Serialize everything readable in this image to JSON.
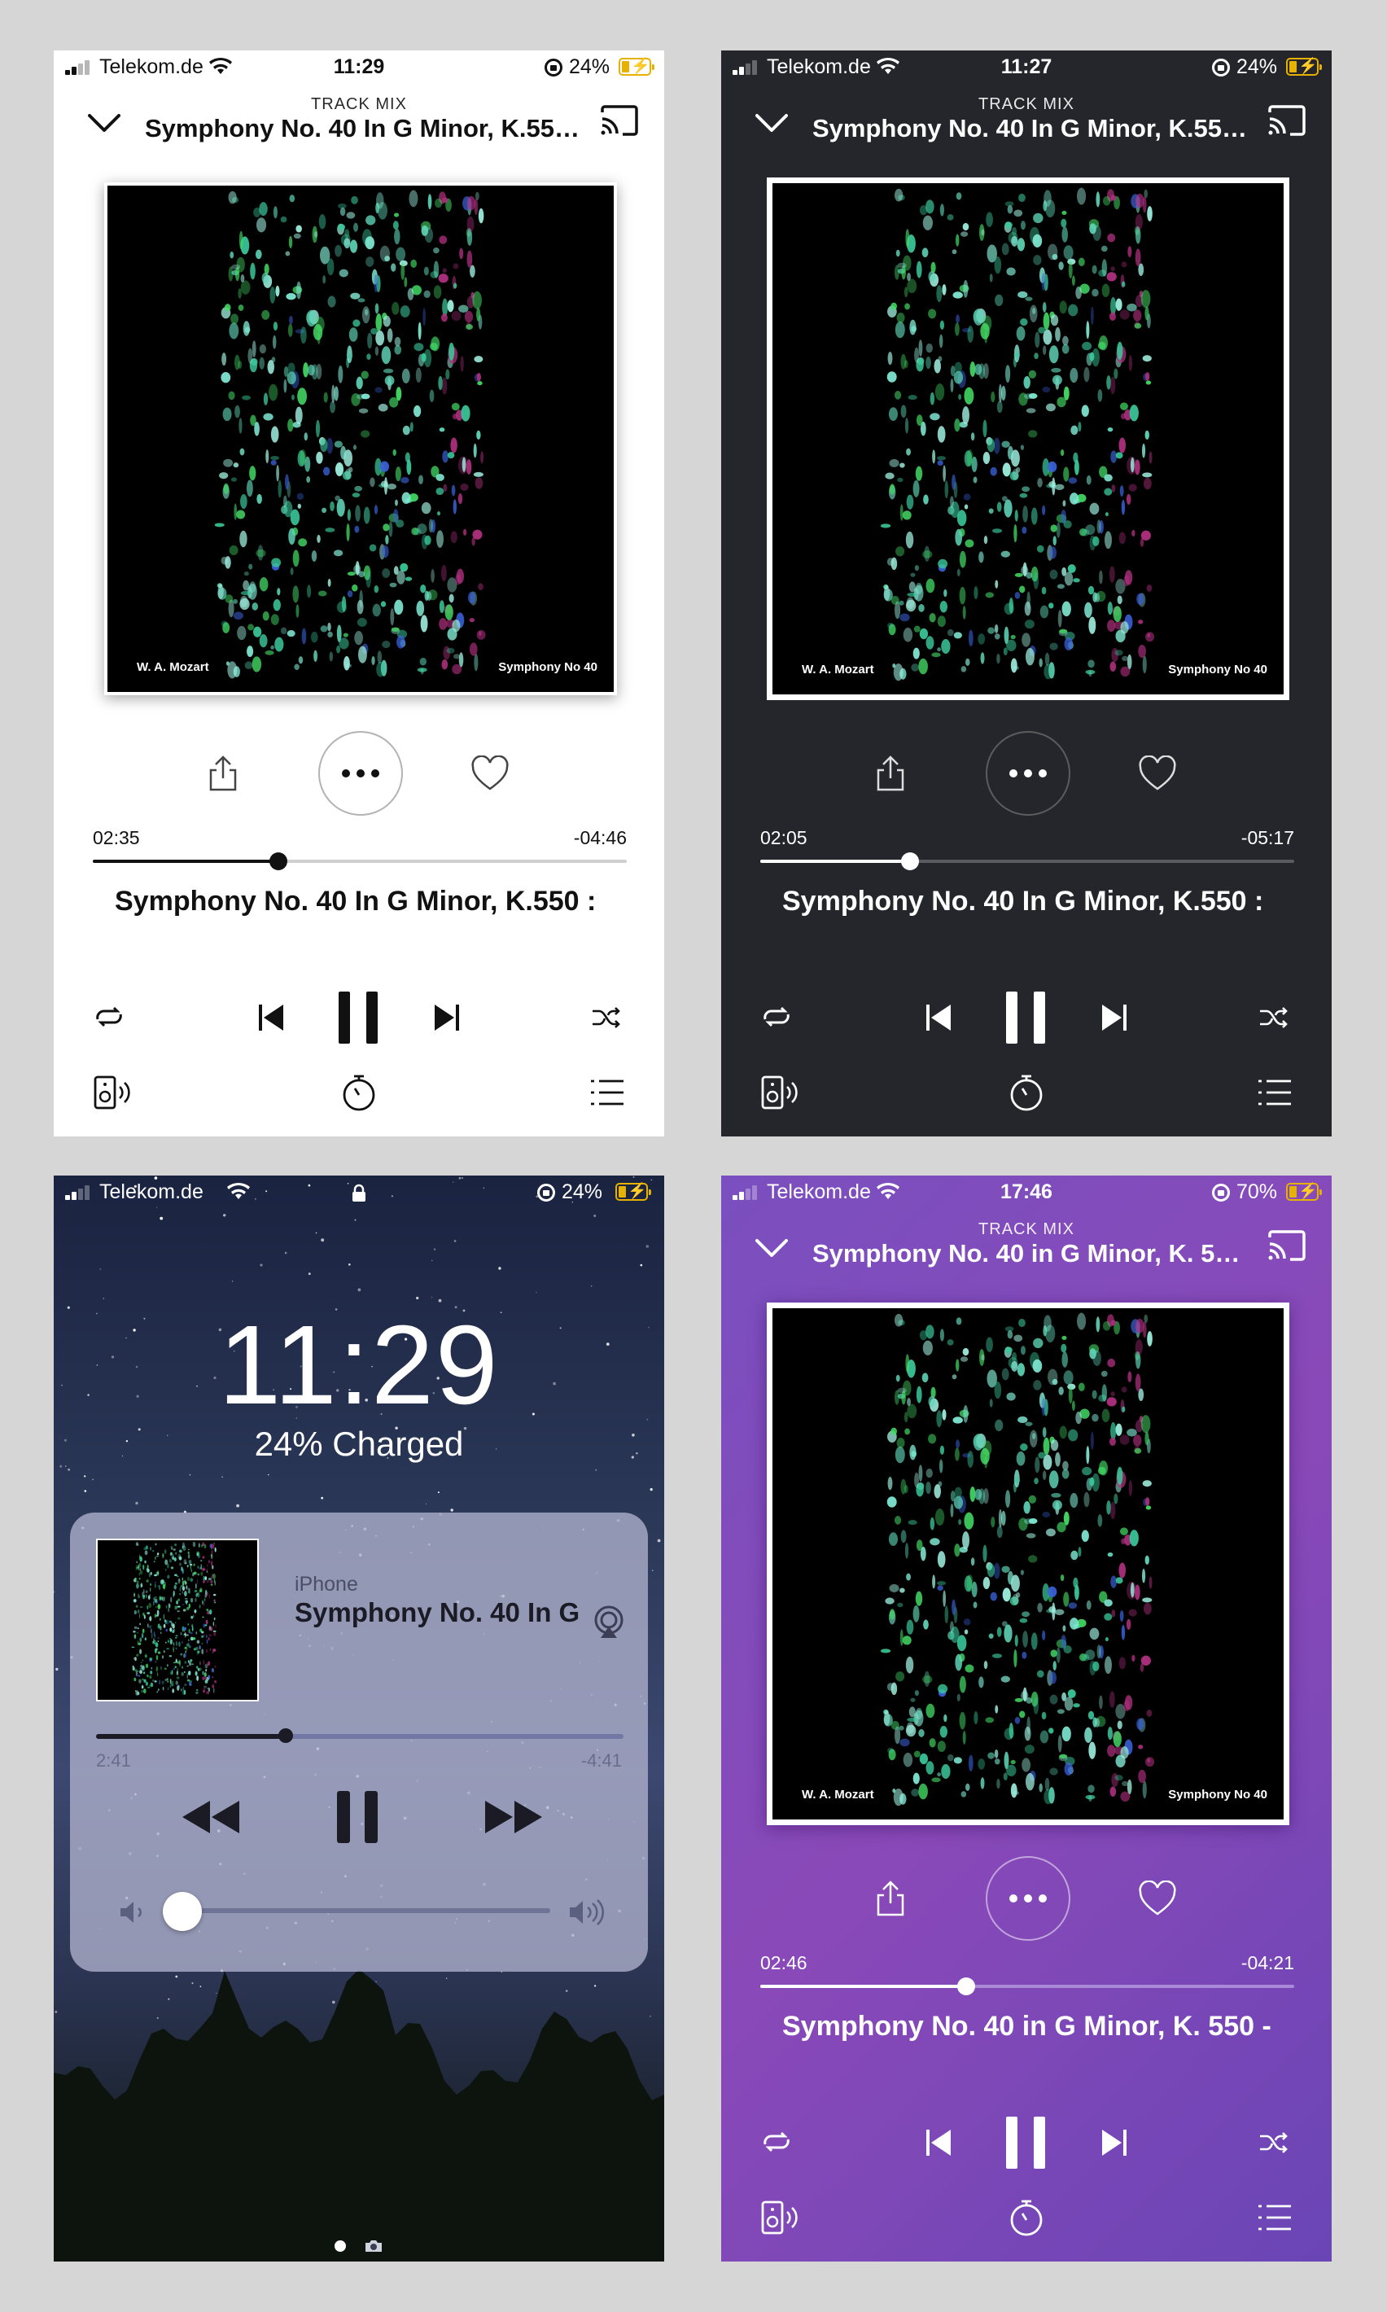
{
  "screens": [
    {
      "theme": "light",
      "status": {
        "carrier": "Telekom.de",
        "time": "11:29",
        "battery": "24%"
      },
      "header": {
        "subtitle": "TRACK MIX",
        "title": "Symphony No. 40 In G Minor, K.550 :..."
      },
      "artwork": {
        "artist": "W. A. Mozart",
        "album": "Symphony No 40"
      },
      "progress": {
        "elapsed": "02:35",
        "remaining": "-04:46",
        "fraction": 0.347
      },
      "song": "Symphony No. 40 In G Minor, K.550 : M",
      "colors": {
        "fg": "#111111",
        "track": "#cfcfcf",
        "fill": "#111111"
      }
    },
    {
      "theme": "dark",
      "status": {
        "carrier": "Telekom.de",
        "time": "11:27",
        "battery": "24%"
      },
      "header": {
        "subtitle": "TRACK MIX",
        "title": "Symphony No. 40 In G Minor, K.550 :..."
      },
      "artwork": {
        "artist": "W. A. Mozart",
        "album": "Symphony No 40"
      },
      "progress": {
        "elapsed": "02:05",
        "remaining": "-05:17",
        "fraction": 0.28
      },
      "song": "Symphony No. 40 In G Minor, K.550 : M",
      "colors": {
        "fg": "#ffffff",
        "track": "#5a5b61",
        "fill": "#ffffff"
      }
    },
    {
      "theme": "lockscreen",
      "status": {
        "carrier": "Telekom.de",
        "battery": "24%"
      },
      "clock": "11:29",
      "charge_text": "24% Charged",
      "player": {
        "device": "iPhone",
        "title": "Symphony No. 40 In G",
        "elapsed": "2:41",
        "remaining": "-4:41",
        "fraction": 0.36,
        "volume": 0.05
      }
    },
    {
      "theme": "purple",
      "status": {
        "carrier": "Telekom.de",
        "time": "17:46",
        "battery": "70%"
      },
      "header": {
        "subtitle": "TRACK MIX",
        "title": "Symphony No. 40 in G Minor, K. 550..."
      },
      "artwork": {
        "artist": "W. A. Mozart",
        "album": "Symphony No 40"
      },
      "progress": {
        "elapsed": "02:46",
        "remaining": "-04:21",
        "fraction": 0.385
      },
      "song": "Symphony No. 40 in G Minor, K. 550 - (",
      "colors": {
        "fg": "#ffffff",
        "track": "#a88ad6",
        "fill": "#ffffff"
      }
    }
  ]
}
